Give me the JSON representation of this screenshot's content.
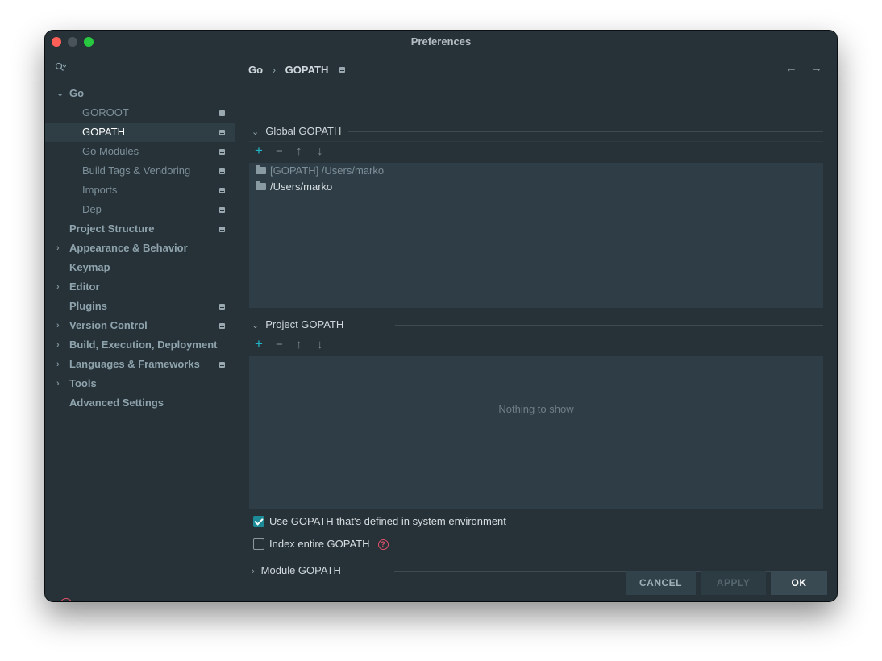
{
  "window": {
    "title": "Preferences"
  },
  "sidebar": {
    "search_placeholder": "",
    "items": [
      {
        "label": "Go",
        "expanded": true,
        "level": 0,
        "chev": "⌄",
        "proj": false
      },
      {
        "label": "GOROOT",
        "level": 1,
        "proj": true
      },
      {
        "label": "GOPATH",
        "level": 1,
        "proj": true,
        "selected": true
      },
      {
        "label": "Go Modules",
        "level": 1,
        "proj": true
      },
      {
        "label": "Build Tags & Vendoring",
        "level": 1,
        "proj": true
      },
      {
        "label": "Imports",
        "level": 1,
        "proj": true
      },
      {
        "label": "Dep",
        "level": 1,
        "proj": true
      },
      {
        "label": "Project Structure",
        "level": 0,
        "proj": true
      },
      {
        "label": "Appearance & Behavior",
        "level": 0,
        "chev": "›"
      },
      {
        "label": "Keymap",
        "level": 0
      },
      {
        "label": "Editor",
        "level": 0,
        "chev": "›"
      },
      {
        "label": "Plugins",
        "level": 0,
        "proj": true
      },
      {
        "label": "Version Control",
        "level": 0,
        "chev": "›",
        "proj": true
      },
      {
        "label": "Build, Execution, Deployment",
        "level": 0,
        "chev": "›"
      },
      {
        "label": "Languages & Frameworks",
        "level": 0,
        "chev": "›",
        "proj": true
      },
      {
        "label": "Tools",
        "level": 0,
        "chev": "›"
      },
      {
        "label": "Advanced Settings",
        "level": 0
      }
    ]
  },
  "breadcrumb": {
    "parent": "Go",
    "current": "GOPATH"
  },
  "global_gopath": {
    "title": "Global GOPATH",
    "entries": [
      {
        "text": "[GOPATH] /Users/marko",
        "dim": true
      },
      {
        "text": "/Users/marko",
        "dim": false
      }
    ]
  },
  "project_gopath": {
    "title": "Project GOPATH",
    "empty_text": "Nothing to show"
  },
  "options": {
    "use_system_gopath": {
      "label": "Use GOPATH that's defined in system environment",
      "checked": true
    },
    "index_entire_gopath": {
      "label": "Index entire GOPATH",
      "checked": false
    }
  },
  "module_gopath": {
    "title": "Module GOPATH"
  },
  "buttons": {
    "cancel": "CANCEL",
    "apply": "APPLY",
    "ok": "OK"
  },
  "toolbar_icons": {
    "add": "+",
    "remove": "−",
    "up": "↑",
    "down": "↓"
  }
}
